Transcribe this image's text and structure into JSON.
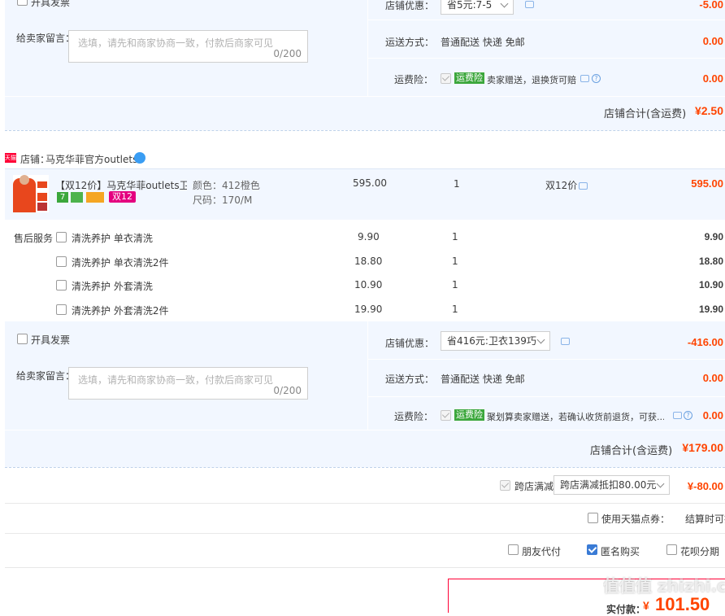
{
  "store1": {
    "invoice_label": "开具发票",
    "shop_discount_label": "店铺优惠：",
    "shop_discount_value": "省5元:7-5",
    "shop_discount_amount": "-5.00",
    "message_label": "给卖家留言：",
    "message_placeholder": "选填，请先和商家协商一致，付款后商家可见",
    "message_count": "0/200",
    "shipping_label": "运送方式：",
    "shipping_value": "普通配送 快递 免邮",
    "shipping_amount": "0.00",
    "insurance_label": "运费险：",
    "insurance_badge": "运费险",
    "insurance_text": "卖家赠送，退换货可赔",
    "insurance_amount": "0.00",
    "total_label": "店铺合计(含运费)",
    "total_value": "¥2.50"
  },
  "store2": {
    "shop_icon": "天猫",
    "shop_label": "店铺：",
    "shop_name": "马克华菲官方outlets",
    "product": {
      "title": "【双12价】马克华菲outlets卫...",
      "color": "颜色：412橙色",
      "size": "尺码：170/M",
      "price": "595.00",
      "qty": "1",
      "promo": "双12价",
      "subtotal": "595.00",
      "badge_7": "7",
      "badge_d12": "双12"
    },
    "after_sales_label": "售后服务",
    "services": [
      {
        "name": "清洗养护 单衣清洗",
        "price": "9.90",
        "qty": "1",
        "subtotal": "9.90"
      },
      {
        "name": "清洗养护 单衣清洗2件",
        "price": "18.80",
        "qty": "1",
        "subtotal": "18.80"
      },
      {
        "name": "清洗养护 外套清洗",
        "price": "10.90",
        "qty": "1",
        "subtotal": "10.90"
      },
      {
        "name": "清洗养护 外套清洗2件",
        "price": "19.90",
        "qty": "1",
        "subtotal": "19.90"
      }
    ],
    "invoice_label": "开具发票",
    "shop_discount_label": "店铺优惠：",
    "shop_discount_value": "省416元:卫衣139巧",
    "shop_discount_amount": "-416.00",
    "message_label": "给卖家留言：",
    "message_placeholder": "选填，请先和商家协商一致，付款后商家可见",
    "message_count": "0/200",
    "shipping_label": "运送方式：",
    "shipping_value": "普通配送 快递 免邮",
    "shipping_amount": "0.00",
    "insurance_label": "运费险：",
    "insurance_badge": "运费险",
    "insurance_text": "聚划算卖家赠送，若确认收货前退货，可获...",
    "insurance_amount": "0.00",
    "total_label": "店铺合计(含运费)",
    "total_value": "¥179.00"
  },
  "cross_store": {
    "label": "跨店满减",
    "select_value": "跨店满减抵扣80.00元",
    "amount": "¥-80.00"
  },
  "tmall_points": {
    "label": "使用天猫点券：",
    "settle_text": "结算时可抵扣"
  },
  "options": {
    "friend_pay": "朋友代付",
    "anonymous": "匿名购买",
    "split": "花呗分期"
  },
  "summary": {
    "actual_label": "实付款：",
    "currency": "¥",
    "actual_value": "101.50"
  },
  "watermark": "值值值 zhizhi.com",
  "colors": {
    "accent_red": "#ff0036",
    "light_blue": "#f2f7ff",
    "insurance_green": "#3ca73c",
    "tmall_red": "#ff0036"
  }
}
